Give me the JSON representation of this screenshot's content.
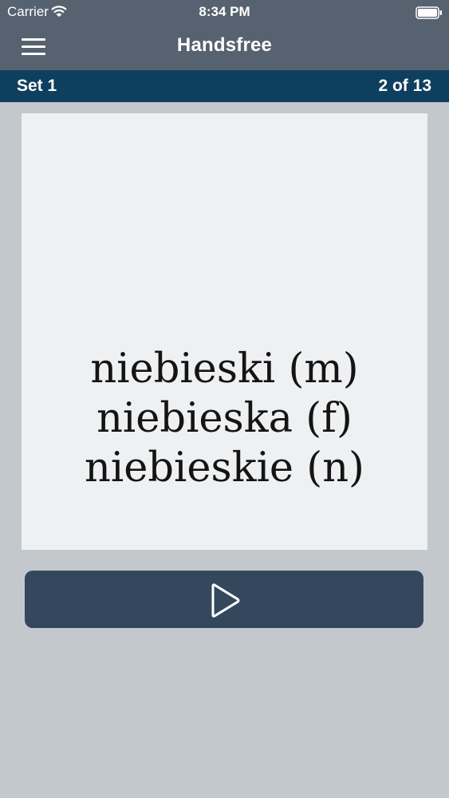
{
  "status_bar": {
    "carrier": "Carrier",
    "time": "8:34 PM",
    "icons": [
      "wifi-icon",
      "battery-icon"
    ]
  },
  "nav": {
    "title": "Handsfree",
    "menu_icon": "hamburger-menu-icon"
  },
  "set_bar": {
    "set_label": "Set 1",
    "counter": "2 of 13"
  },
  "card": {
    "lines": [
      "niebieski (m)",
      "niebieska (f)",
      "niebieskie (n)"
    ]
  },
  "controls": {
    "play_icon": "play-icon"
  },
  "colors": {
    "bar": "#56626f",
    "set_bar": "#0f3f5e",
    "background": "#c3c8cd",
    "card": "#eef0f2",
    "button": "#34485d"
  }
}
